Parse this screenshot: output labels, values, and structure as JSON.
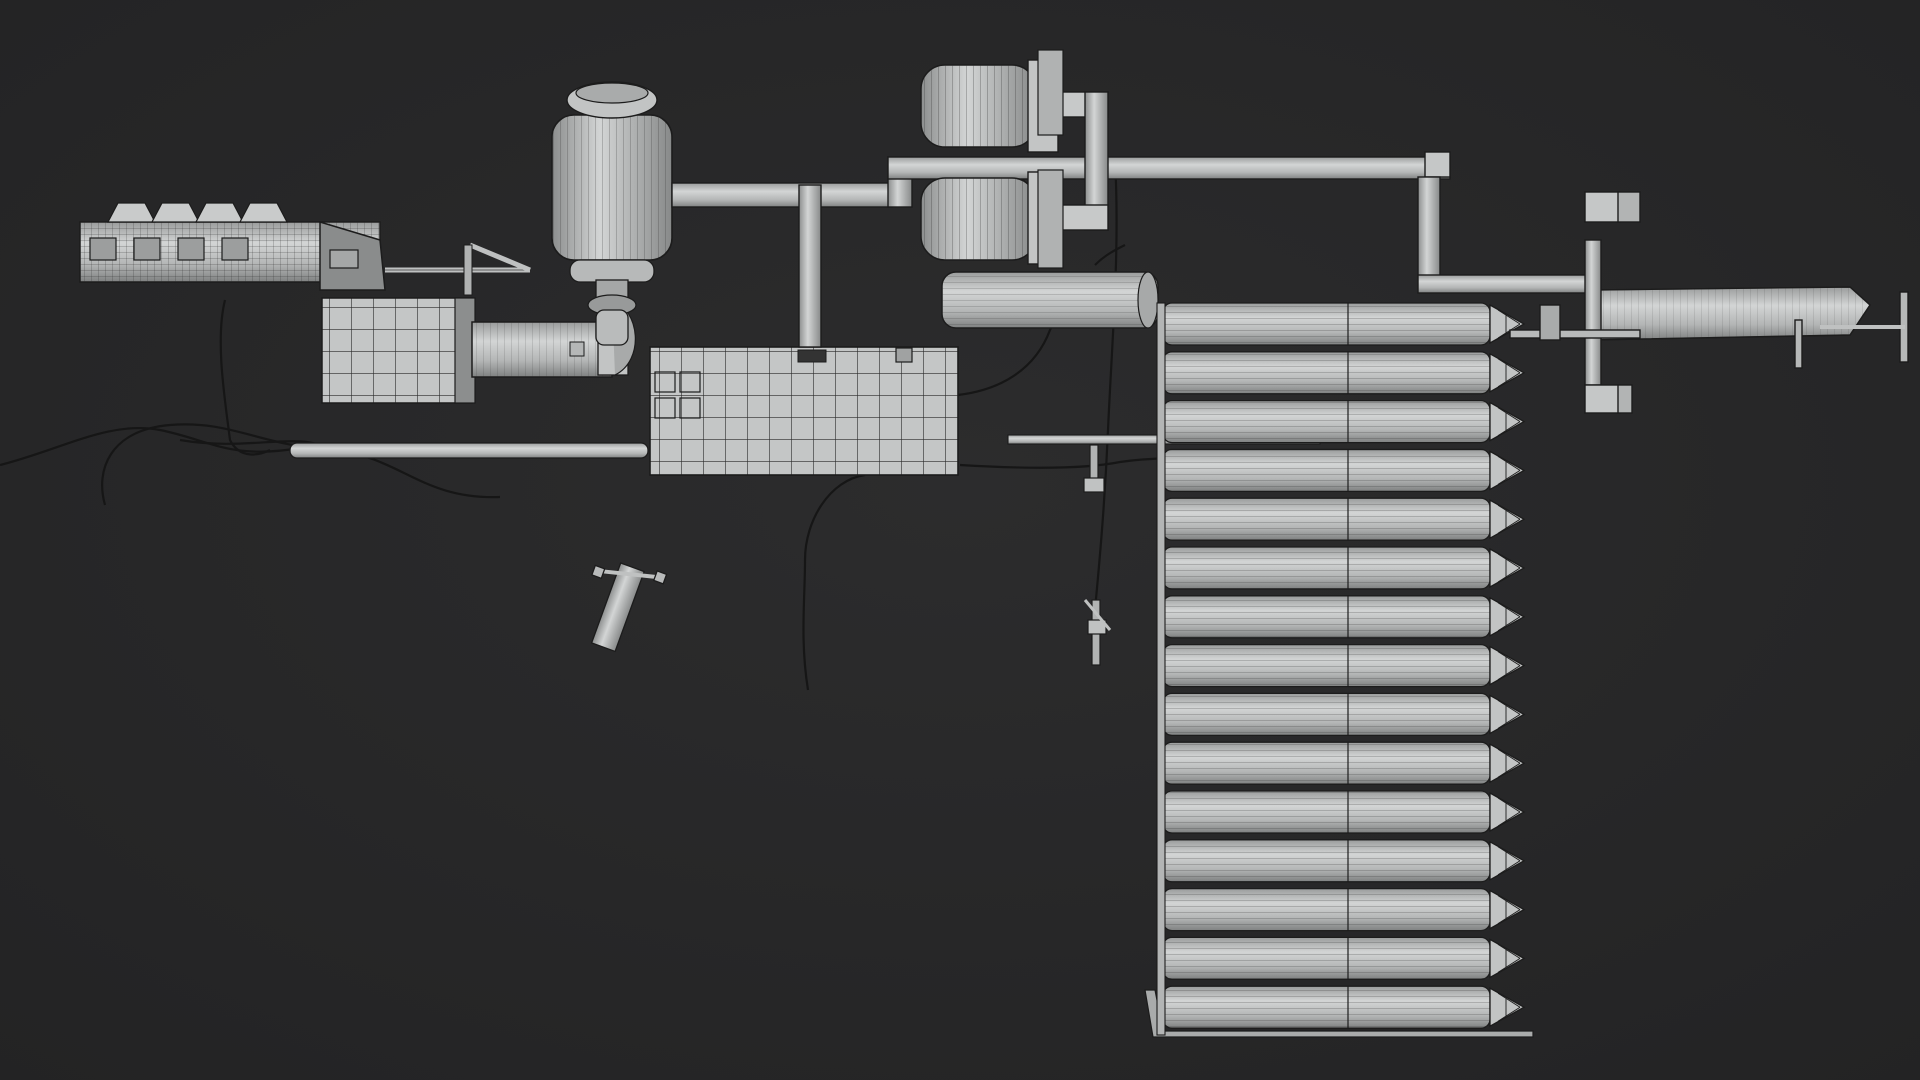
{
  "viewport": {
    "background": "#2c2c2d",
    "background_edge": "#232324",
    "mesh_fill": "#b9bbbb",
    "mesh_fill_light": "#d0d2d2",
    "mesh_shade": "#8f9191",
    "wire_color": "#1c1c1c",
    "cable_color": "#161616",
    "shading": "wireframe-overlay",
    "objects": [
      "engine-block",
      "electric-motor",
      "intake-manifold-box",
      "control-panel-box",
      "twin-cooling-fans",
      "exhaust-pipe-network",
      "horizontal-tank",
      "ammo-belt-stack",
      "mount-bracket-arm",
      "small-clamp-part",
      "floating-cables"
    ],
    "ammo_round_count": 15
  }
}
